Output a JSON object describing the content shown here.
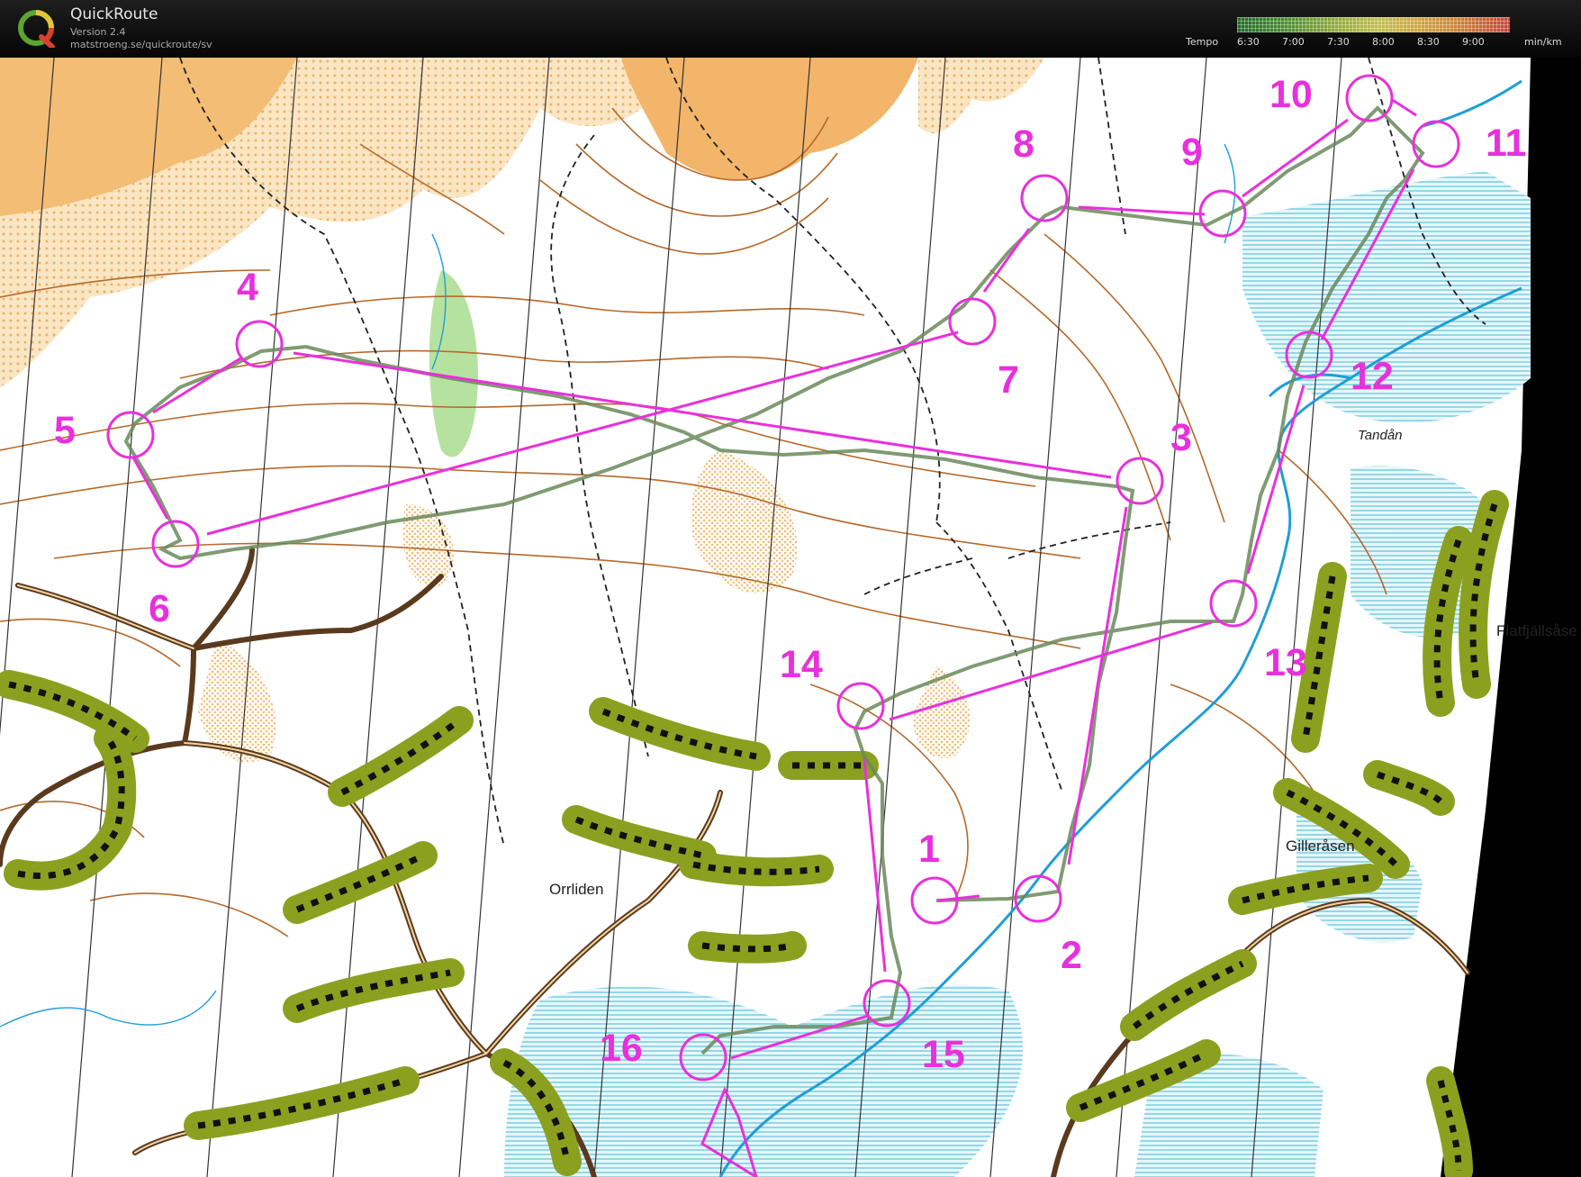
{
  "app": {
    "name": "QuickRoute",
    "version": "Version 2.4",
    "url": "matstroeng.se/quickroute/sv",
    "logo_letter": "Q"
  },
  "legend": {
    "label": "Tempo",
    "unit": "min/km",
    "ticks": [
      "6:30",
      "7:00",
      "7:30",
      "8:00",
      "8:30",
      "9:00"
    ]
  },
  "course": {
    "color": "#e830dc",
    "controls": [
      {
        "number": "1"
      },
      {
        "number": "2"
      },
      {
        "number": "3"
      },
      {
        "number": "4"
      },
      {
        "number": "5"
      },
      {
        "number": "6"
      },
      {
        "number": "7"
      },
      {
        "number": "8"
      },
      {
        "number": "9"
      },
      {
        "number": "10"
      },
      {
        "number": "11"
      },
      {
        "number": "12"
      },
      {
        "number": "13"
      },
      {
        "number": "14"
      },
      {
        "number": "15"
      },
      {
        "number": "16"
      }
    ]
  },
  "place_names": {
    "orrliden": "Orrliden",
    "gilleråsen": "Gilleråsen",
    "flatfjällsåsen": "Flatfjällsåse",
    "tandån": "Tandån"
  },
  "colors": {
    "open_land": "#f5c88a",
    "vegetation": "#9ab02a",
    "marsh": "#7fd0e0",
    "contour": "#b5692a",
    "route": "#6a8a5a"
  }
}
